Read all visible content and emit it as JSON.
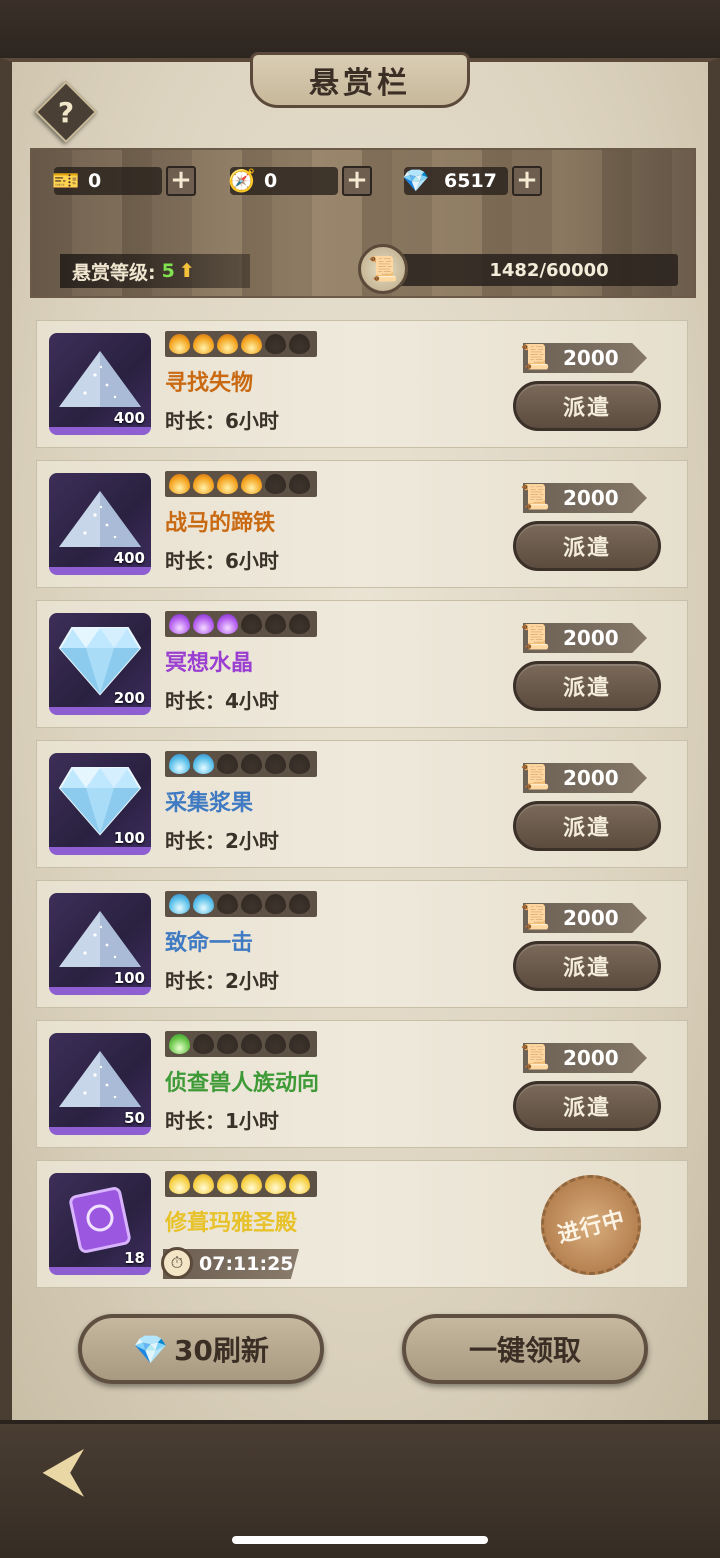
{
  "header": {
    "title": "悬赏栏",
    "help_label": "?"
  },
  "currencies": [
    {
      "icon": "ticket-icon",
      "value": "0"
    },
    {
      "icon": "compass-icon",
      "value": "0"
    },
    {
      "icon": "diamond-icon",
      "value": "6517"
    }
  ],
  "bounty": {
    "level_label": "悬赏等级:",
    "level_value": "5",
    "level_up_glyph": "⬆",
    "xp": "1482/60000"
  },
  "durations_prefix": "时长：",
  "dispatch_label": "派遣",
  "quests": [
    {
      "name": "寻找失物",
      "duration": "时长：6小时",
      "reward": "2000",
      "qty": "400",
      "item": "dust",
      "flames": [
        "orange",
        "orange",
        "orange",
        "orange",
        "off",
        "off"
      ],
      "color": "#c96a12"
    },
    {
      "name": "战马的蹄铁",
      "duration": "时长：6小时",
      "reward": "2000",
      "qty": "400",
      "item": "dust",
      "flames": [
        "orange",
        "orange",
        "orange",
        "orange",
        "off",
        "off"
      ],
      "color": "#c96a12"
    },
    {
      "name": "冥想水晶",
      "duration": "时长：4小时",
      "reward": "2000",
      "qty": "200",
      "item": "diamond",
      "flames": [
        "purple",
        "purple",
        "purple",
        "off",
        "off",
        "off"
      ],
      "color": "#9a3fd2"
    },
    {
      "name": "采集浆果",
      "duration": "时长：2小时",
      "reward": "2000",
      "qty": "100",
      "item": "diamond",
      "flames": [
        "blue",
        "blue",
        "off",
        "off",
        "off",
        "off"
      ],
      "color": "#3f7ac2"
    },
    {
      "name": "致命一击",
      "duration": "时长：2小时",
      "reward": "2000",
      "qty": "100",
      "item": "dust",
      "flames": [
        "blue",
        "blue",
        "off",
        "off",
        "off",
        "off"
      ],
      "color": "#3f7ac2"
    },
    {
      "name": "侦查兽人族动向",
      "duration": "时长：1小时",
      "reward": "2000",
      "qty": "50",
      "item": "dust",
      "flames": [
        "green",
        "off",
        "off",
        "off",
        "off",
        "off"
      ],
      "color": "#3e9a36"
    }
  ],
  "active_quest": {
    "name": "修葺玛雅圣殿",
    "timer": "07:11:25",
    "qty": "18",
    "status": "进行中",
    "flames": [
      "gold",
      "gold",
      "gold",
      "gold",
      "gold",
      "gold"
    ],
    "color": "#e8c22a"
  },
  "buttons": {
    "refresh_cost": "30刷新",
    "claim_all": "一键领取"
  },
  "footer": {
    "back_glyph": "⮜"
  }
}
